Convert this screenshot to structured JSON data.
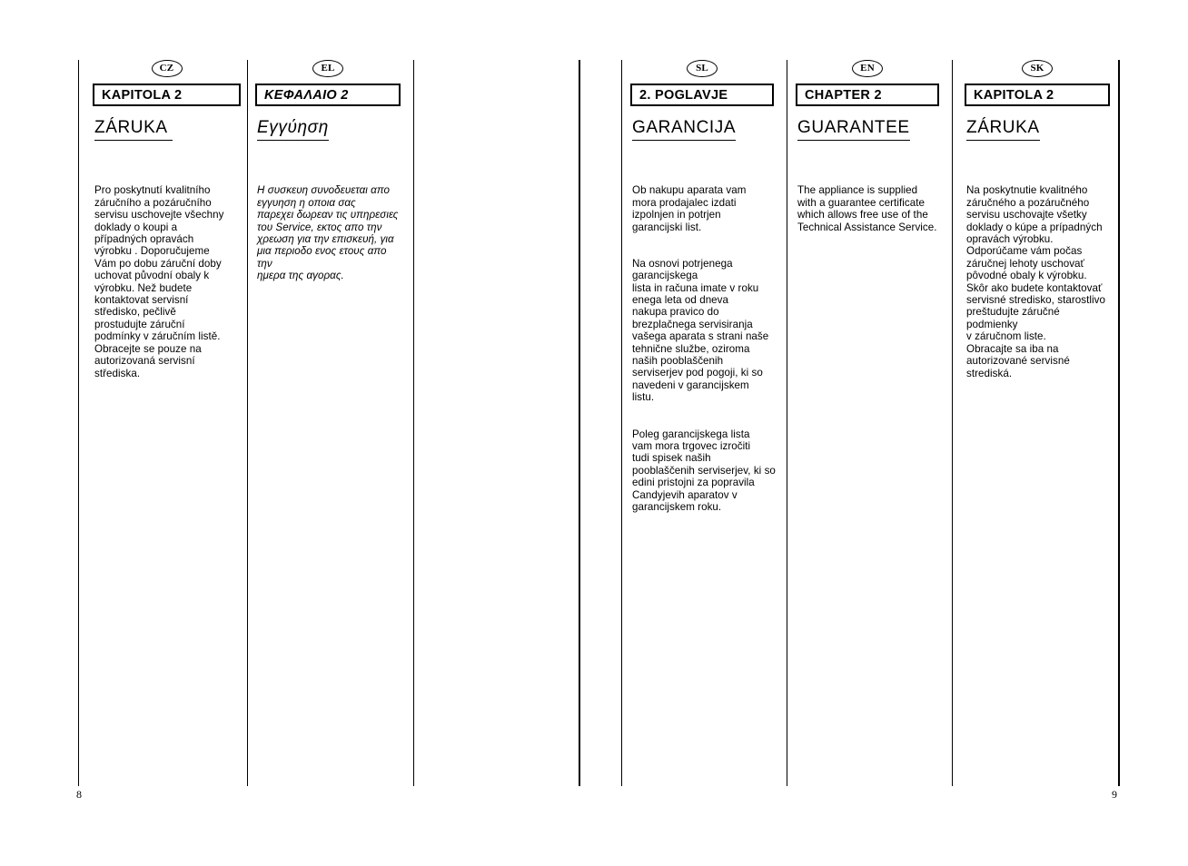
{
  "document": {
    "page_left": "8",
    "page_right": "9"
  },
  "columns": [
    {
      "badge": "CZ",
      "chapter": "KAPITOLA 2",
      "heading": "ZÁRUKA ",
      "paragraphs": [
        "Pro poskytnutí kvalitního\nzáručního a pozáručního\nservisu uschovejte všechny\ndoklady o koupi a\npřípadných opravách\nvýrobku . Doporučujeme\nVám po dobu záruční doby\nuchovat původní obaly k\nvýrobku. Než budete\nkontaktovat servisní\nstředisko, pečlivě\nprostudujte záruční\npodmínky v záručním listě.\nObracejte se pouze na\nautorizovaná servisní\nstřediska."
      ]
    },
    {
      "badge": "EL",
      "chapter": "ΚΕΦΑΛΑΙΟ 2",
      "heading": "Εγγύηση",
      "paragraphs": [
        "Η συσκευη συνοδευεται απο\nεγγυηση η οποια σας\nπαρεχει δωρεαν τις υπηρεσιες\nτου Service, εκτος απο την\nχρεωση για την επισκευή, για\nμια περιοδο ενος ετους απο την\nημερα της αγορας."
      ]
    },
    {
      "badge": "SL",
      "chapter": "2. POGLAVJE",
      "heading": "GARANCIJA",
      "paragraphs": [
        "Ob nakupu aparata vam\nmora prodajalec izdati\nizpolnjen in potrjen\ngarancijski list.",
        "Na osnovi potrjenega\ngarancijskega\nlista in računa imate v roku\nenega leta od dneva\nnakupa pravico do\nbrezplačnega servisiranja\nvašega aparata s strani naše\ntehnične službe, oziroma\nnaših pooblaščenih\nserviserjev pod pogoji, ki so\nnavedeni v garancijskem\nlistu.",
        "Poleg garancijskega lista\nvam mora trgovec izročiti\ntudi spisek naših\npooblaščenih serviserjev, ki so\nedini pristojni za popravila\nCandyjevih aparatov v\ngarancijskem roku."
      ]
    },
    {
      "badge": "EN",
      "chapter": "CHAPTER 2",
      "heading": "GUARANTEE",
      "paragraphs": [
        "The appliance is supplied\nwith a guarantee certificate\nwhich allows free use of the\nTechnical Assistance Service."
      ]
    },
    {
      "badge": "SK",
      "chapter": "KAPITOLA 2",
      "heading": "ZÁRUKA",
      "paragraphs": [
        "Na poskytnutie kvalitného\nzáručného a pozáručného\nservisu uschovajte všetky\ndoklady o kúpe a prípadných\nopravách výrobku.\nOdporúčame vám počas\nzáručnej lehoty uschovať\npôvodné obaly k výrobku.\nSkôr ako budete kontaktovať\nservisné stredisko, starostlivo\npreštudujte záručné podmienky\nv záručnom liste.\nObracajte sa iba na\nautorizované servisné\nstrediská."
      ]
    }
  ]
}
